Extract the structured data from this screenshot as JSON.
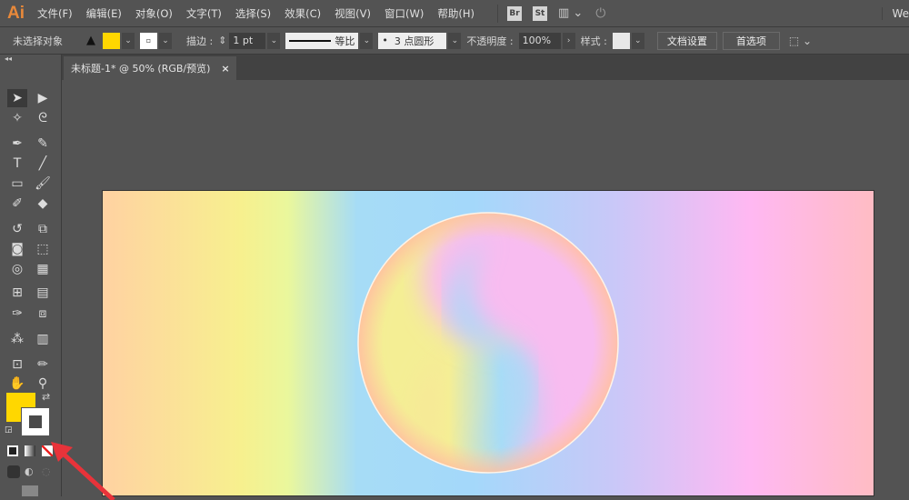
{
  "app": {
    "logo": "Ai",
    "workspace": "We"
  },
  "menu": [
    "文件(F)",
    "编辑(E)",
    "对象(O)",
    "文字(T)",
    "选择(S)",
    "效果(C)",
    "视图(V)",
    "窗口(W)",
    "帮助(H)"
  ],
  "menu_icons": {
    "bridge": "Br",
    "stock": "St"
  },
  "control": {
    "selection": "未选择对象",
    "fill_color": "#ffd700",
    "stroke_label": "描边 :",
    "stroke_weight": "1 pt",
    "profile": "等比",
    "brush": "3 点圆形",
    "opacity_label": "不透明度 :",
    "opacity": "100%",
    "style_label": "样式 :",
    "doc_setup": "文档设置",
    "preferences": "首选项"
  },
  "document_tab": {
    "title": "未标题-1* @ 50% (RGB/预览)",
    "close": "×"
  },
  "tools": [
    "selection",
    "direct-selection",
    "magic-wand",
    "lasso",
    "pen",
    "curvature",
    "type",
    "line",
    "rectangle",
    "paintbrush",
    "shaper",
    "eraser",
    "rotate",
    "scale",
    "warp",
    "free-transform",
    "shape-builder",
    "perspective-grid",
    "mesh",
    "gradient",
    "eyedropper",
    "blend",
    "symbol-sprayer",
    "column-graph",
    "artboard",
    "slice",
    "hand",
    "zoom"
  ],
  "colors": {
    "fill": "#ffd700",
    "stroke": "#ffffff",
    "annotation_arrow": "#e8333a"
  }
}
